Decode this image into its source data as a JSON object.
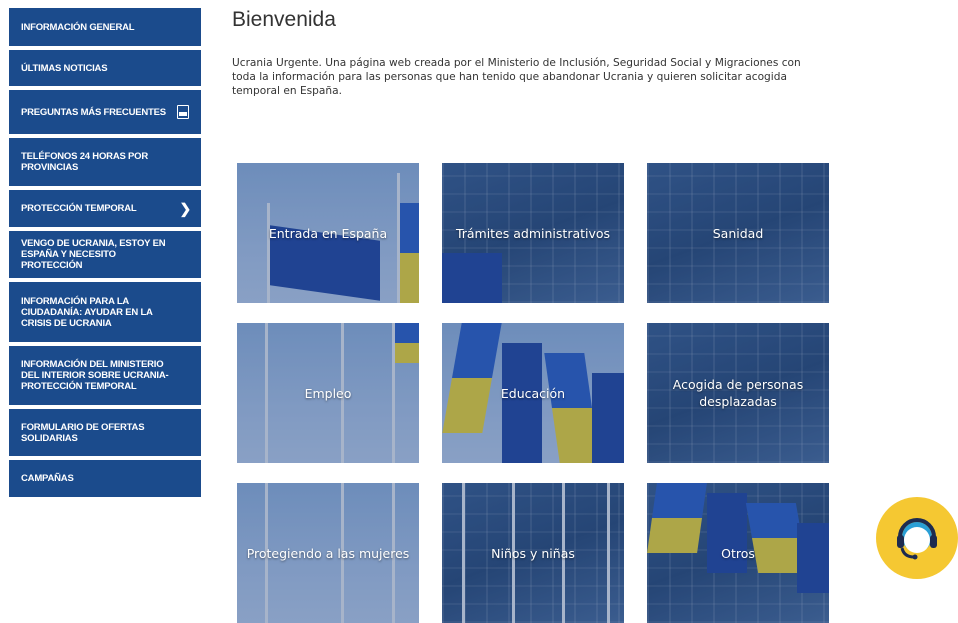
{
  "sidebar": {
    "items": [
      {
        "label": "INFORMACIÓN GENERAL"
      },
      {
        "label": "ÚLTIMAS NOTICIAS"
      },
      {
        "label": "PREGUNTAS MÁS FRECUENTES"
      },
      {
        "label": "TELÉFONOS 24 HORAS POR PROVINCIAS"
      },
      {
        "label": "PROTECCIÓN TEMPORAL"
      },
      {
        "label": "VENGO DE UCRANIA, ESTOY EN ESPAÑA Y NECESITO PROTECCIÓN"
      },
      {
        "label": "INFORMACIÓN PARA LA CIUDADANÍA: AYUDAR EN LA CRISIS DE UCRANIA"
      },
      {
        "label": "INFORMACIÓN DEL MINISTERIO DEL INTERIOR SOBRE UCRANIA-PROTECCIÓN TEMPORAL"
      },
      {
        "label": "FORMULARIO DE OFERTAS SOLIDARIAS"
      },
      {
        "label": "CAMPAÑAS"
      }
    ]
  },
  "main": {
    "title": "Bienvenida",
    "intro": "Ucrania Urgente. Una página web creada por el Ministerio de Inclusión, Seguridad Social y Migraciones con toda la información para las personas que han tenido que abandonar Ucrania y quieren solicitar acogida temporal en España."
  },
  "tiles": [
    {
      "label": "Entrada en España"
    },
    {
      "label": "Trámites administrativos"
    },
    {
      "label": "Sanidad"
    },
    {
      "label": "Empleo"
    },
    {
      "label": "Educación"
    },
    {
      "label": "Acogida de personas desplazadas"
    },
    {
      "label": "Protegiendo a las mujeres"
    },
    {
      "label": "Niños y niñas"
    },
    {
      "label": "Otros"
    }
  ],
  "colors": {
    "sidebar": "#1b4b8c",
    "help_button": "#f5c832"
  },
  "icons": {
    "pdf": "pdf-icon",
    "chevron": "chevron-right-icon",
    "help": "headset-help-icon"
  }
}
